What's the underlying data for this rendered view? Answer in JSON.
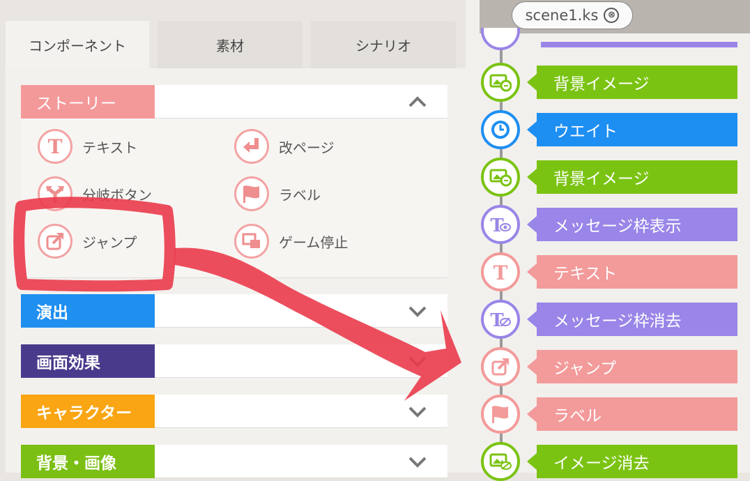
{
  "tabs": [
    "コンポーネント",
    "素材",
    "シナリオ"
  ],
  "sections": {
    "story": "ストーリー",
    "effect": "演出",
    "screen": "画面効果",
    "chara": "キャラクター",
    "bg": "背景・画像"
  },
  "story_components": [
    "テキスト",
    "改ページ",
    "分岐ボタン",
    "ラベル",
    "ジャンプ",
    "ゲーム停止"
  ],
  "scene_tab": {
    "label": "scene1.ks",
    "close_glyph": "⊗"
  },
  "timeline": [
    {
      "label": "背景イメージ",
      "color": "#7bc313",
      "icon": "background-image-icon"
    },
    {
      "label": "ウエイト",
      "color": "#1e8ff2",
      "icon": "clock-icon"
    },
    {
      "label": "背景イメージ",
      "color": "#7bc313",
      "icon": "background-image-icon"
    },
    {
      "label": "メッセージ枠表示",
      "color": "#9a85e8",
      "icon": "message-show-icon"
    },
    {
      "label": "テキスト",
      "color": "#f39a9a",
      "icon": "text-icon"
    },
    {
      "label": "メッセージ枠消去",
      "color": "#9a85e8",
      "icon": "message-hide-icon"
    },
    {
      "label": "ジャンプ",
      "color": "#f39a9a",
      "icon": "jump-icon"
    },
    {
      "label": "ラベル",
      "color": "#f39a9a",
      "icon": "flag-icon"
    },
    {
      "label": "イメージ消去",
      "color": "#7bc313",
      "icon": "image-clear-icon"
    }
  ],
  "colors": {
    "story": "#f4999a",
    "effect": "#1f8ff0",
    "screen": "#4a3a8c",
    "chara": "#f9a514",
    "bg": "#7bbf14",
    "annotation": "#ea3b4b"
  }
}
